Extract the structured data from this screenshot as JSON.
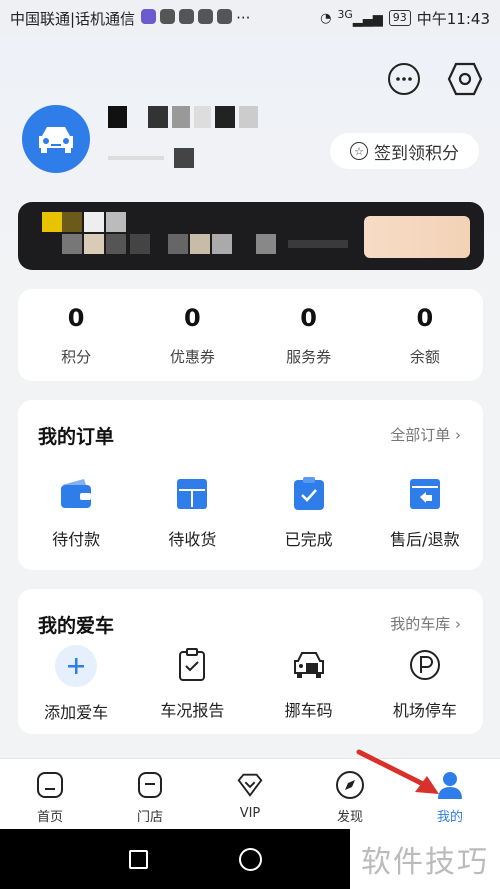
{
  "status_bar": {
    "carrier": "中国联通|话机通信",
    "signal": "3G",
    "battery": "93",
    "time": "中午11:43"
  },
  "header": {
    "signin_label": "签到领积分",
    "icons": [
      "message-icon",
      "settings-icon"
    ]
  },
  "stats": [
    {
      "value": "0",
      "label": "积分"
    },
    {
      "value": "0",
      "label": "优惠券"
    },
    {
      "value": "0",
      "label": "服务券"
    },
    {
      "value": "0",
      "label": "余额"
    }
  ],
  "orders": {
    "title": "我的订单",
    "link": "全部订单",
    "items": [
      {
        "label": "待付款",
        "icon": "wallet-icon"
      },
      {
        "label": "待收货",
        "icon": "package-icon"
      },
      {
        "label": "已完成",
        "icon": "check-clipboard-icon"
      },
      {
        "label": "售后/退款",
        "icon": "return-icon"
      }
    ]
  },
  "cars": {
    "title": "我的爱车",
    "link": "我的车库",
    "items": [
      {
        "label": "添加爱车",
        "icon": "plus-icon"
      },
      {
        "label": "车况报告",
        "icon": "report-icon"
      },
      {
        "label": "挪车码",
        "icon": "move-car-icon"
      },
      {
        "label": "机场停车",
        "icon": "parking-icon"
      }
    ]
  },
  "tabbar": [
    {
      "label": "首页",
      "icon": "home-icon"
    },
    {
      "label": "门店",
      "icon": "store-icon"
    },
    {
      "label": "VIP",
      "icon": "vip-icon"
    },
    {
      "label": "发现",
      "icon": "discover-icon"
    },
    {
      "label": "我的",
      "icon": "profile-icon",
      "active": true
    }
  ],
  "watermark": "软件技巧",
  "colors": {
    "accent": "#2f7de8",
    "arrow": "#d9302c"
  }
}
